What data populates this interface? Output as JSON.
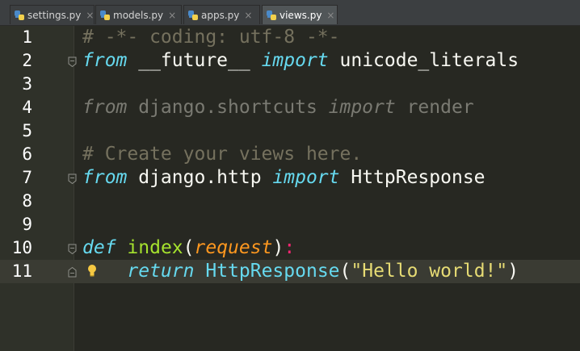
{
  "tabs": [
    {
      "label": "settings.py",
      "active": false
    },
    {
      "label": "models.py",
      "active": false
    },
    {
      "label": "apps.py",
      "active": false
    },
    {
      "label": "views.py",
      "active": true
    }
  ],
  "tab_close_glyph": "×",
  "icons": {
    "file_icon": "python-file-icon",
    "fold": "fold-marker-icon",
    "hint": "lightbulb-icon"
  },
  "colors": {
    "background": "#272822",
    "keyword": "#66d9ef",
    "comment": "#75715e",
    "function": "#a6e22e",
    "parameter": "#fd971f",
    "operator": "#f92672",
    "string": "#e6db74",
    "text": "#f8f8f2"
  },
  "current_line": 11,
  "lines": [
    {
      "num": "1",
      "tokens": [
        {
          "t": "# -*- coding: utf-8 -*-",
          "c": "comment"
        }
      ]
    },
    {
      "num": "2",
      "tokens": [
        {
          "t": "from",
          "c": "kw"
        },
        {
          "t": " __future__ ",
          "c": "plain"
        },
        {
          "t": "import",
          "c": "kw"
        },
        {
          "t": " unicode_literals",
          "c": "plain"
        }
      ]
    },
    {
      "num": "3",
      "tokens": []
    },
    {
      "num": "4",
      "tokens": [
        {
          "t": "from",
          "c": "dimkw"
        },
        {
          "t": " django.shortcuts ",
          "c": "dim"
        },
        {
          "t": "import",
          "c": "dimkw"
        },
        {
          "t": " render",
          "c": "dim"
        }
      ]
    },
    {
      "num": "5",
      "tokens": []
    },
    {
      "num": "6",
      "tokens": [
        {
          "t": "# Create your views here.",
          "c": "comment"
        }
      ]
    },
    {
      "num": "7",
      "tokens": [
        {
          "t": "from",
          "c": "kw"
        },
        {
          "t": " django.http ",
          "c": "plain"
        },
        {
          "t": "import",
          "c": "kw"
        },
        {
          "t": " HttpResponse",
          "c": "plain"
        }
      ]
    },
    {
      "num": "8",
      "tokens": []
    },
    {
      "num": "9",
      "tokens": []
    },
    {
      "num": "10",
      "tokens": [
        {
          "t": "def",
          "c": "kw"
        },
        {
          "t": " ",
          "c": "plain"
        },
        {
          "t": "index",
          "c": "fn"
        },
        {
          "t": "(",
          "c": "plain"
        },
        {
          "t": "request",
          "c": "param"
        },
        {
          "t": ")",
          "c": "plain"
        },
        {
          "t": ":",
          "c": "op"
        }
      ]
    },
    {
      "num": "11",
      "tokens": [
        {
          "t": "    ",
          "c": "plain"
        },
        {
          "t": "return",
          "c": "kw"
        },
        {
          "t": " ",
          "c": "plain"
        },
        {
          "t": "HttpResponse",
          "c": "kwplain"
        },
        {
          "t": "(",
          "c": "plain"
        },
        {
          "t": "\"Hello world!\"",
          "c": "str"
        },
        {
          "t": ")",
          "c": "plain"
        }
      ]
    }
  ]
}
